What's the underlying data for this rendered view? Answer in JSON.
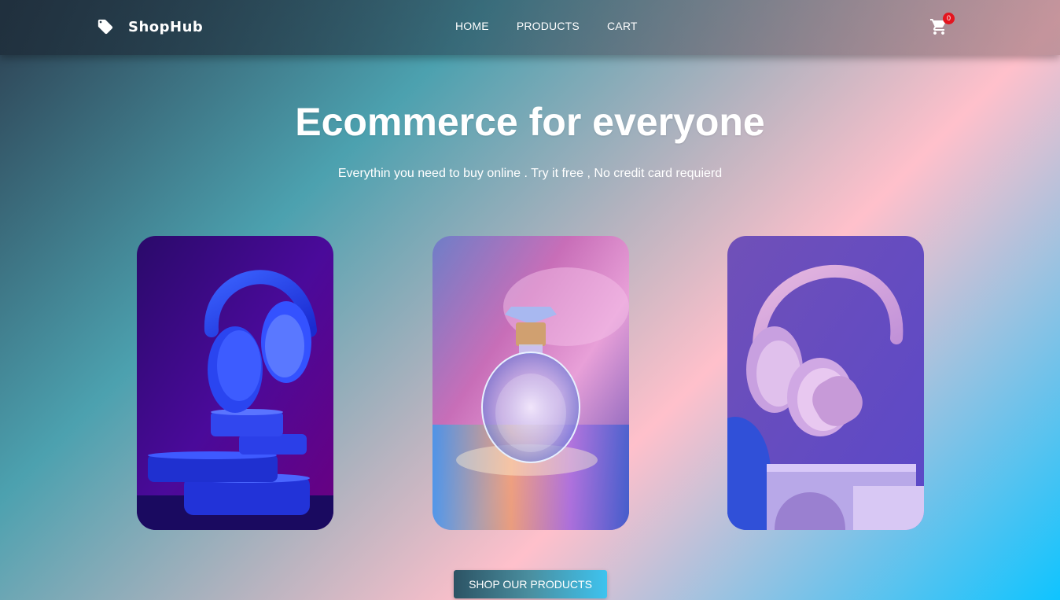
{
  "header": {
    "brand_icon": "tag-icon",
    "brand_name": "ShopHub",
    "nav": [
      {
        "label": "HOME"
      },
      {
        "label": "PRODUCTS"
      },
      {
        "label": "CART"
      }
    ],
    "cart_icon": "shopping-cart-icon",
    "cart_count": "0"
  },
  "hero": {
    "title": "Ecommerce for everyone",
    "subtitle": "Everythin you need to buy online . Try it free , No credit card requierd"
  },
  "cards": [
    {
      "image": "headphones-on-podium-image"
    },
    {
      "image": "perfume-bottle-image"
    },
    {
      "image": "pink-headphones-image"
    }
  ],
  "cta": {
    "label": "SHOP OUR PRODUCTS"
  },
  "colors": {
    "badge": "#e4151f",
    "gradient_start": "#2c3e50",
    "gradient_mid": "#ffc0cb",
    "gradient_end": "#0fc4ff"
  }
}
